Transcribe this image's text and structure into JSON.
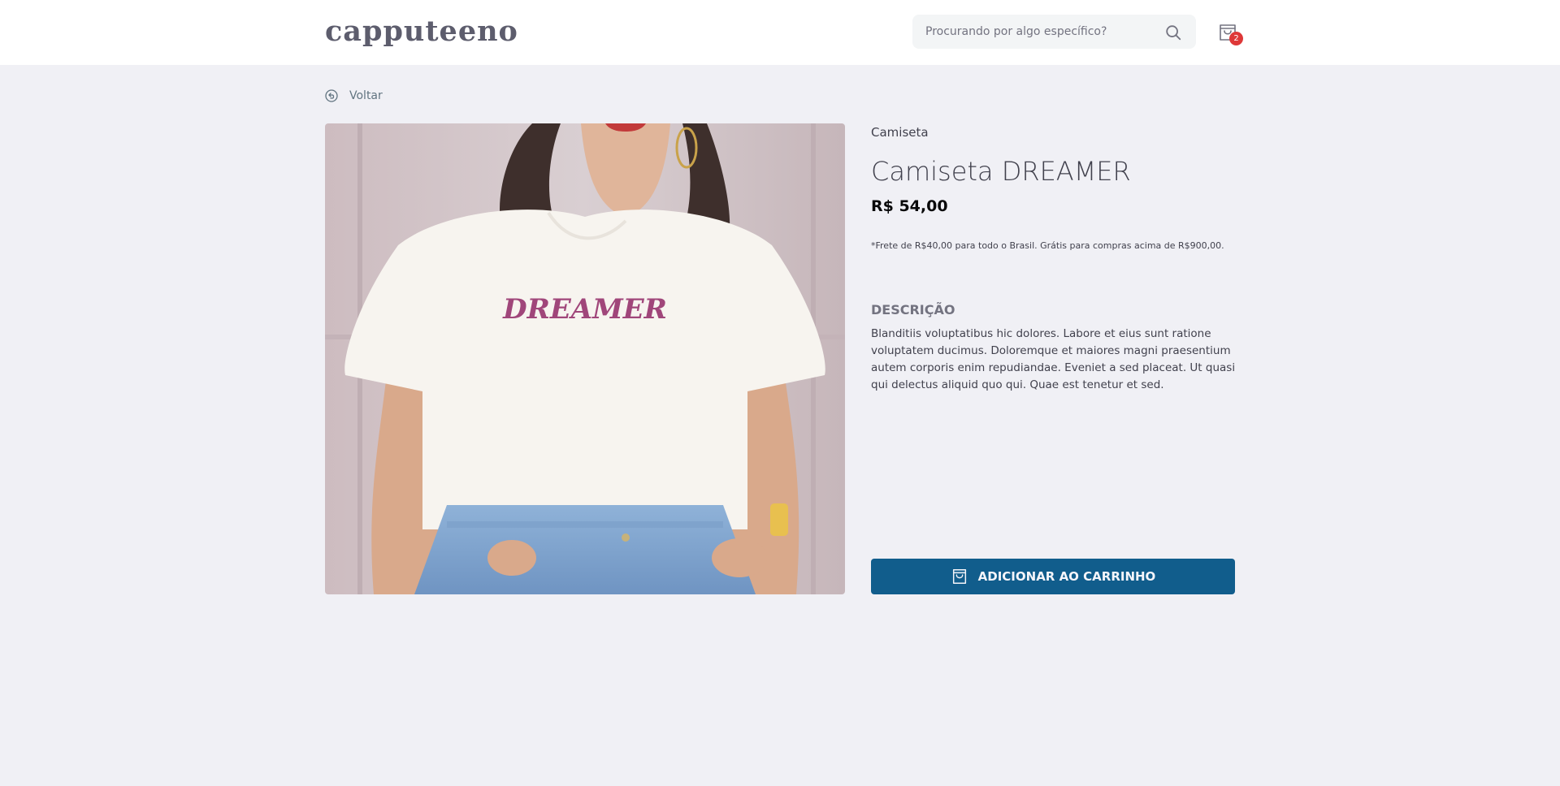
{
  "header": {
    "logo": "capputeeno",
    "search": {
      "placeholder": "Procurando por algo específico?",
      "value": "",
      "icon": "search-icon"
    },
    "cart": {
      "icon": "shopping-bag-icon",
      "count": "2",
      "badge_color": "#de3838"
    }
  },
  "back": {
    "label": "Voltar",
    "icon": "back-arrow-icon"
  },
  "product": {
    "category": "Camiseta",
    "name": "Camiseta DREAMER",
    "price": "R$ 54,00",
    "shipping_note": "*Frete de R$40,00 para todo o Brasil. Grátis para compras acima de R$900,00.",
    "description_heading": "DESCRIÇÃO",
    "description": "Blanditiis voluptatibus hic dolores. Labore et eius sunt ratione voluptatem ducimus. Doloremque et maiores magni praesentium autem corporis enim repudiandae. Eveniet a sed placeat. Ut quasi qui delectus aliquid quo qui. Quae est tenetur et sed.",
    "image_print_text": "DREAMER",
    "add_to_cart_label": "ADICIONAR AO CARRINHO",
    "add_to_cart_icon": "shopping-bag-icon"
  },
  "colors": {
    "background": "#f0f0f5",
    "header": "#ffffff",
    "primary_button": "#115d8c",
    "text": "#41414d",
    "price": "#09090a"
  }
}
